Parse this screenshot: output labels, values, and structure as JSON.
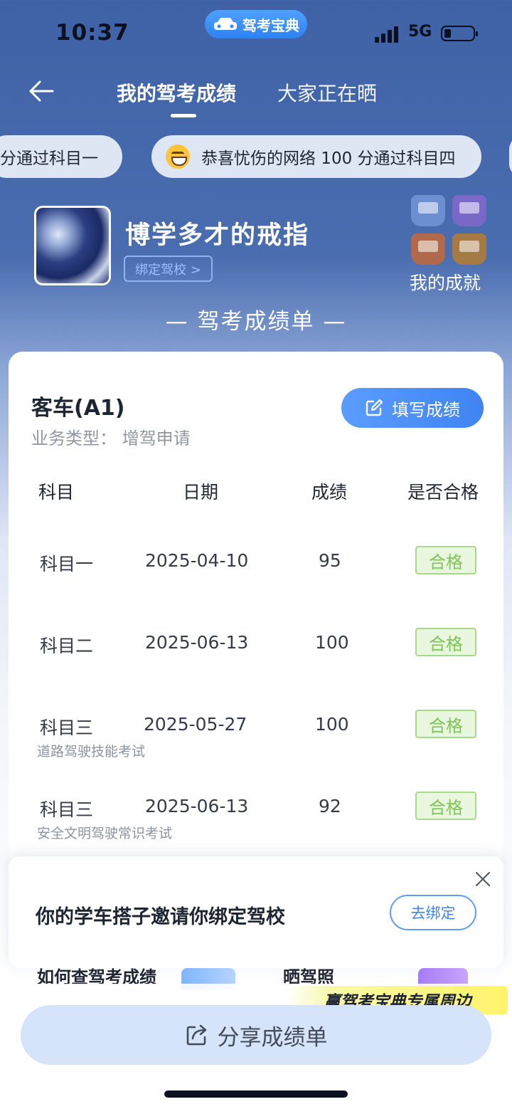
{
  "status_bar": {
    "time": "10:37",
    "network": "5G",
    "app_name": "驾考宝典"
  },
  "nav": {
    "tabs": [
      {
        "label": "我的驾考成绩",
        "active": true
      },
      {
        "label": "大家正在晒",
        "active": false
      }
    ]
  },
  "ticker": [
    {
      "text": "分通过科目一"
    },
    {
      "text": "恭喜忧伤的网络 100 分通过科目四"
    }
  ],
  "profile": {
    "username": "博学多才的戒指",
    "bind_school_label": "绑定驾校 >",
    "achievements_label": "我的成就",
    "badges": [
      {
        "icon": "badge-subject1-icon",
        "color": "#6b8fd1"
      },
      {
        "icon": "badge-subject2-icon",
        "color": "#7a68c9"
      },
      {
        "icon": "badge-subject3-icon",
        "color": "#b06a4b"
      },
      {
        "icon": "badge-subject4-icon",
        "color": "#a57a44"
      }
    ]
  },
  "section_title": "— 驾考成绩单 —",
  "card": {
    "car_type": "客车(A1)",
    "business_type": "业务类型：  增驾申请",
    "fill_button_label": "填写成绩",
    "headers": {
      "subject": "科目",
      "date": "日期",
      "score": "成绩",
      "passed": "是否合格"
    },
    "rows": [
      {
        "subject": "科目一",
        "date": "2025-04-10",
        "score": "95",
        "status": "合格",
        "sub": ""
      },
      {
        "subject": "科目二",
        "date": "2025-06-13",
        "score": "100",
        "status": "合格",
        "sub": ""
      },
      {
        "subject": "科目三",
        "date": "2025-05-27",
        "score": "100",
        "status": "合格",
        "sub": "道路驾驶技能考试"
      },
      {
        "subject": "科目三",
        "date": "2025-06-13",
        "score": "92",
        "status": "合格",
        "sub": "安全文明驾驶常识考试"
      }
    ]
  },
  "popup": {
    "text": "你的学车搭子邀请你绑定驾校",
    "button_label": "去绑定"
  },
  "peek": {
    "item1": "如何查驾考成绩",
    "item2": "晒驾照"
  },
  "promo_banner": "赢驾考宝典专属周边",
  "share_button_label": "分享成绩单",
  "colors": {
    "brand_blue": "#3f84f2",
    "pass_green": "#7fc35a",
    "header_bg": "#4a6db0"
  }
}
